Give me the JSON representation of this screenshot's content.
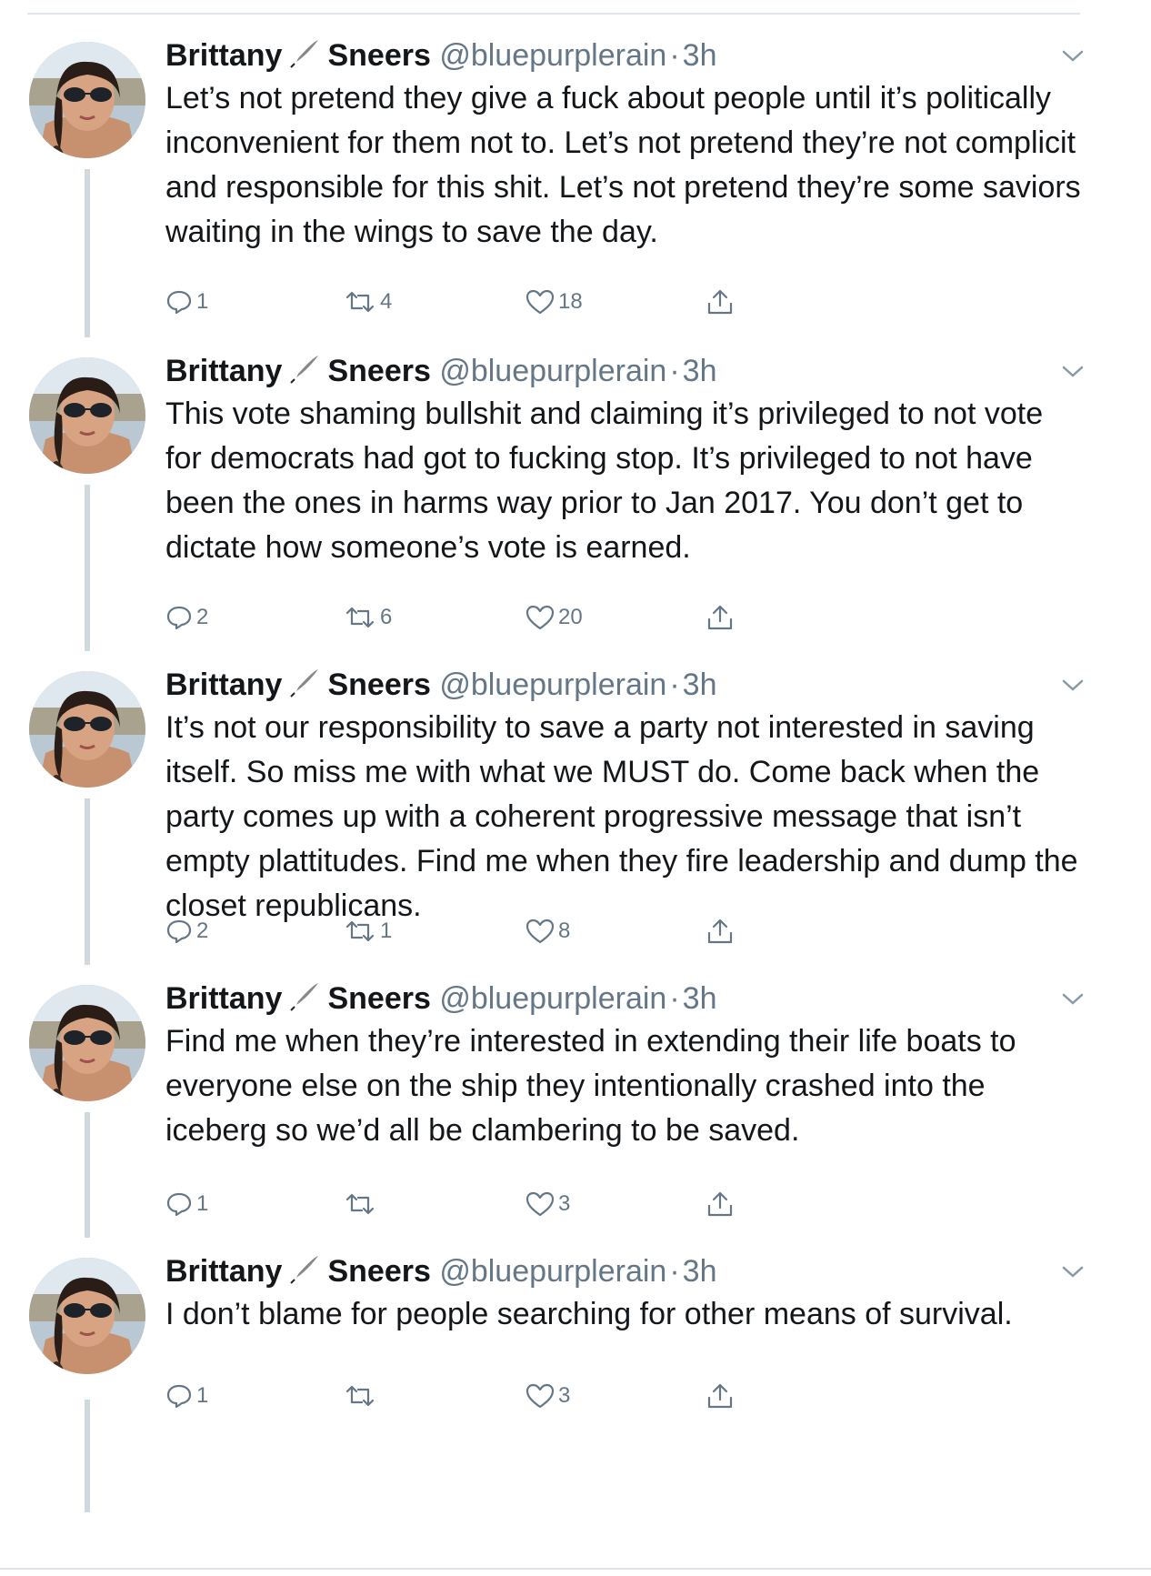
{
  "tweets": [
    {
      "name_first": "Brittany",
      "name_last": "Sneers",
      "handle": "@bluepurplerain",
      "separator": "·",
      "time": "3h",
      "text": "Let’s not pretend they give a fuck about people until it’s politically inconvenient for them not to. Let’s not pretend they’re not complicit and responsible for this shit. Let’s not pretend they’re some saviors waiting in the wings to save the day.",
      "replies": "1",
      "retweets": "4",
      "likes": "18"
    },
    {
      "name_first": "Brittany",
      "name_last": "Sneers",
      "handle": "@bluepurplerain",
      "separator": "·",
      "time": "3h",
      "text": "This vote shaming bullshit and claiming it’s privileged to not vote for democrats had got to fucking stop. It’s privileged to not have been the ones in harms way prior to Jan 2017. You don’t get to dictate how someone’s vote is earned.",
      "replies": "2",
      "retweets": "6",
      "likes": "20"
    },
    {
      "name_first": "Brittany",
      "name_last": "Sneers",
      "handle": "@bluepurplerain",
      "separator": "·",
      "time": "3h",
      "text": "It’s not our responsibility to save a party not interested in saving itself. So miss me with what we MUST do. Come back when the party comes up with a coherent progressive message that isn’t empty plattitudes. Find me when they fire leadership and dump the closet republicans.",
      "replies": "2",
      "retweets": "1",
      "likes": "8"
    },
    {
      "name_first": "Brittany",
      "name_last": "Sneers",
      "handle": "@bluepurplerain",
      "separator": "·",
      "time": "3h",
      "text": "Find me when they’re interested in extending their life boats to everyone else on the ship they intentionally crashed into the iceberg so we’d all be clambering to be saved.",
      "replies": "1",
      "retweets": "",
      "likes": "3"
    },
    {
      "name_first": "Brittany",
      "name_last": "Sneers",
      "handle": "@bluepurplerain",
      "separator": "·",
      "time": "3h",
      "text": "I don’t blame for people searching for other means of survival.",
      "replies": "1",
      "retweets": "",
      "likes": "3"
    }
  ],
  "icons": {
    "reply": "reply-icon",
    "retweet": "retweet-icon",
    "like": "heart-icon",
    "share": "share-icon",
    "more": "chevron-down-icon",
    "name_emoji": "quill-pen-icon"
  },
  "colors": {
    "text": "#14171a",
    "secondary": "#657786",
    "thread_line": "#cfd9de",
    "divider": "#dfe5ea"
  }
}
